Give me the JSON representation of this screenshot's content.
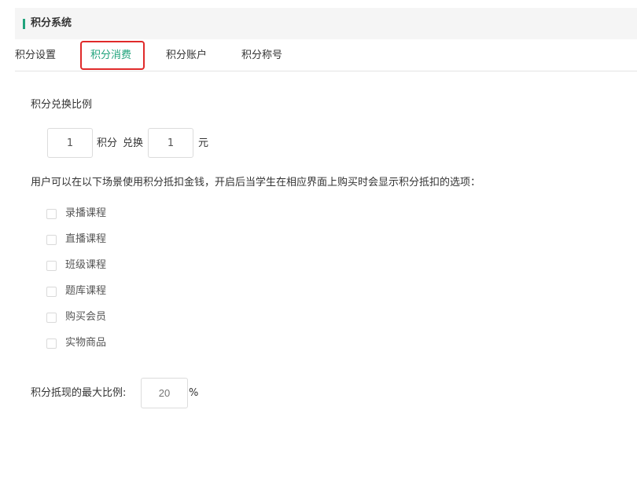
{
  "header": {
    "title": "积分系统"
  },
  "tabs": [
    {
      "label": "积分设置",
      "active": false
    },
    {
      "label": "积分消费",
      "active": true
    },
    {
      "label": "积分账户",
      "active": false
    },
    {
      "label": "积分称号",
      "active": false
    }
  ],
  "exchange": {
    "section_label": "积分兑换比例",
    "points_value": "1",
    "points_unit": "积分",
    "exchange_word": "兑换",
    "money_value": "1",
    "money_unit": "元"
  },
  "usage": {
    "description": "用户可以在以下场景使用积分抵扣金钱，开启后当学生在相应界面上购买时会显示积分抵扣的选项：",
    "options": [
      {
        "label": "录播课程",
        "checked": false
      },
      {
        "label": "直播课程",
        "checked": false
      },
      {
        "label": "班级课程",
        "checked": false
      },
      {
        "label": "题库课程",
        "checked": false
      },
      {
        "label": "购买会员",
        "checked": false
      },
      {
        "label": "实物商品",
        "checked": false
      }
    ]
  },
  "max_ratio": {
    "label": "积分抵现的最大比例:",
    "placeholder": "20",
    "unit": "%"
  },
  "colors": {
    "accent": "#20a37c",
    "highlight": "#e02a2a"
  }
}
